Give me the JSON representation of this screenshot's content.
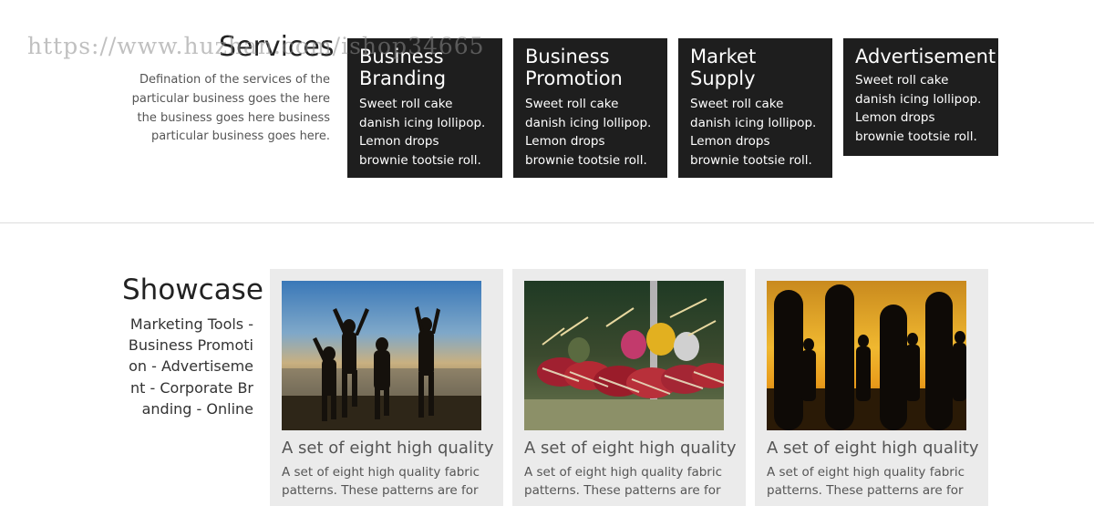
{
  "watermark": "https://www.huzhan.com/ishop34665",
  "services": {
    "title": "Services",
    "description": "Defination of the services of the particular business goes the here the business goes here business particular business goes here.",
    "cards": [
      {
        "title": "Business Branding",
        "text": "Sweet roll cake danish icing lollipop. Lemon drops brownie tootsie roll."
      },
      {
        "title": "Business Promotion",
        "text": "Sweet roll cake danish icing lollipop. Lemon drops brownie tootsie roll."
      },
      {
        "title": "Market Supply",
        "text": "Sweet roll cake danish icing lollipop. Lemon drops brownie tootsie roll."
      },
      {
        "title": "Advertisement",
        "text": "Sweet roll cake danish icing lollipop. Lemon drops brownie tootsie roll."
      }
    ]
  },
  "showcase": {
    "title": "Showcase",
    "categories": "Marketing Tools - Business Promotion - Advertisement - Corporate Branding - Online",
    "cards": [
      {
        "image": "beach-jumping-silhouettes-photo",
        "title": "A set of eight high quality",
        "text": "A set of eight high quality fabric patterns. These patterns are for"
      },
      {
        "image": "drummers-festival-photo",
        "title": "A set of eight high quality",
        "text": "A set of eight high quality fabric patterns. These patterns are for"
      },
      {
        "image": "surfboards-sunset-photo",
        "title": "A set of eight high quality",
        "text": "A set of eight high quality fabric patterns. These patterns are for"
      }
    ]
  },
  "colors": {
    "card_dark": "#1e1e1e",
    "card_light": "#ebebeb",
    "divider": "#dddddd"
  }
}
